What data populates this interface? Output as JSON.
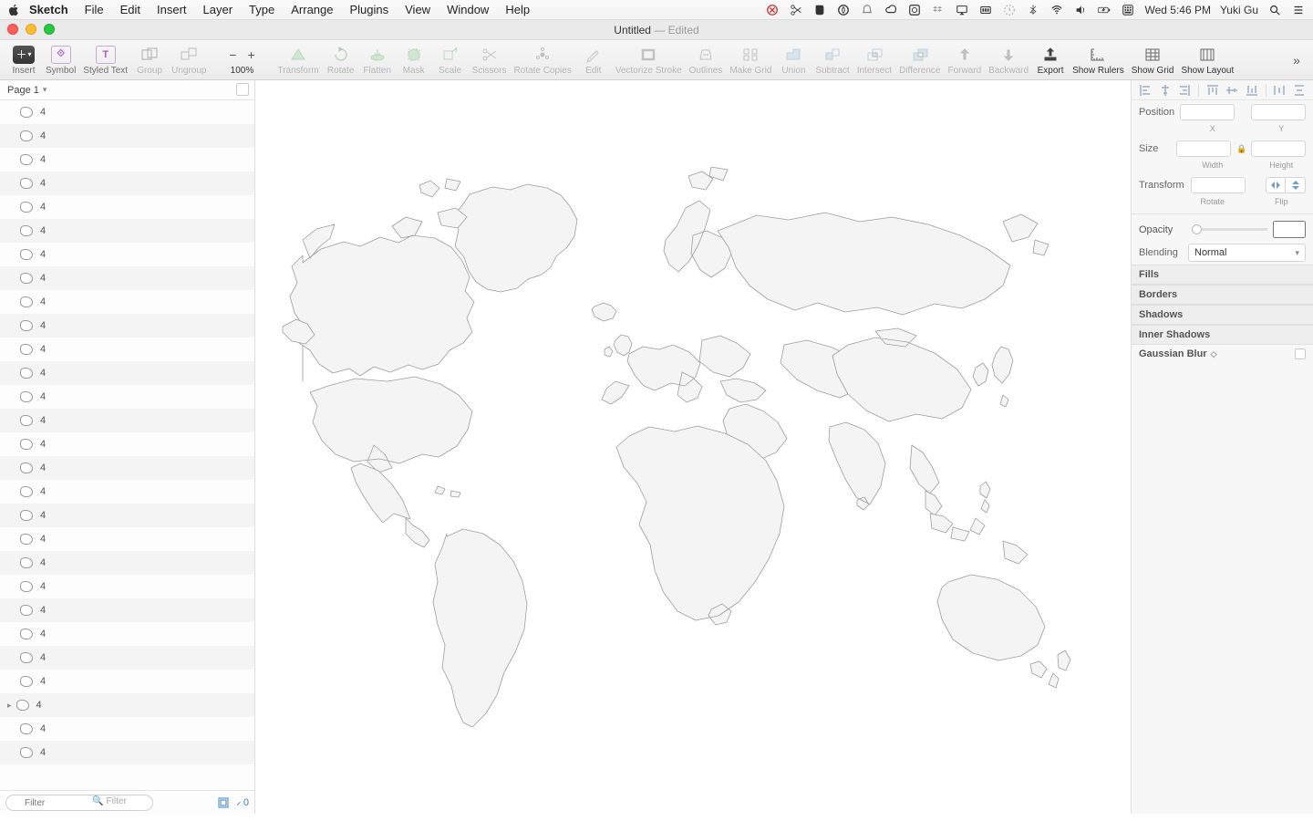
{
  "menubar": {
    "app": "Sketch",
    "items": [
      "File",
      "Edit",
      "Insert",
      "Layer",
      "Type",
      "Arrange",
      "Plugins",
      "View",
      "Window",
      "Help"
    ],
    "clock": "Wed 5:46 PM",
    "user": "Yuki Gu"
  },
  "window": {
    "title_doc": "Untitled",
    "title_suffix": " — Edited"
  },
  "toolbar": {
    "insert": "Insert",
    "symbol": "Symbol",
    "styled_text": "Styled Text",
    "group": "Group",
    "ungroup": "Ungroup",
    "zoom_value": "100%",
    "transform": "Transform",
    "rotate": "Rotate",
    "flatten": "Flatten",
    "mask": "Mask",
    "scale": "Scale",
    "scissors": "Scissors",
    "rotate_copies": "Rotate Copies",
    "edit": "Edit",
    "vectorize_stroke": "Vectorize Stroke",
    "outlines": "Outlines",
    "make_grid": "Make Grid",
    "union": "Union",
    "subtract": "Subtract",
    "intersect": "Intersect",
    "difference": "Difference",
    "forward": "Forward",
    "backward": "Backward",
    "export": "Export",
    "show_rulers": "Show Rulers",
    "show_grid": "Show Grid",
    "show_layout": "Show Layout"
  },
  "left_panel": {
    "page_label": "Page 1",
    "filter_placeholder": "Filter",
    "edit_count": "0",
    "layers": [
      {
        "name": "4"
      },
      {
        "name": "4"
      },
      {
        "name": "4"
      },
      {
        "name": "4"
      },
      {
        "name": "4"
      },
      {
        "name": "4"
      },
      {
        "name": "4"
      },
      {
        "name": "4"
      },
      {
        "name": "4"
      },
      {
        "name": "4"
      },
      {
        "name": "4"
      },
      {
        "name": "4"
      },
      {
        "name": "4"
      },
      {
        "name": "4"
      },
      {
        "name": "4"
      },
      {
        "name": "4"
      },
      {
        "name": "4"
      },
      {
        "name": "4"
      },
      {
        "name": "4"
      },
      {
        "name": "4"
      },
      {
        "name": "4"
      },
      {
        "name": "4"
      },
      {
        "name": "4"
      },
      {
        "name": "4"
      },
      {
        "name": "4"
      },
      {
        "name": "4",
        "group": true
      },
      {
        "name": "4"
      },
      {
        "name": "4"
      }
    ]
  },
  "inspector": {
    "position_label": "Position",
    "x_label": "X",
    "y_label": "Y",
    "size_label": "Size",
    "width_label": "Width",
    "height_label": "Height",
    "transform_label": "Transform",
    "rotate_label": "Rotate",
    "flip_label": "Flip",
    "opacity_label": "Opacity",
    "blending_label": "Blending",
    "blending_value": "Normal",
    "fills": "Fills",
    "borders": "Borders",
    "shadows": "Shadows",
    "inner_shadows": "Inner Shadows",
    "gaussian_blur": "Gaussian Blur"
  }
}
